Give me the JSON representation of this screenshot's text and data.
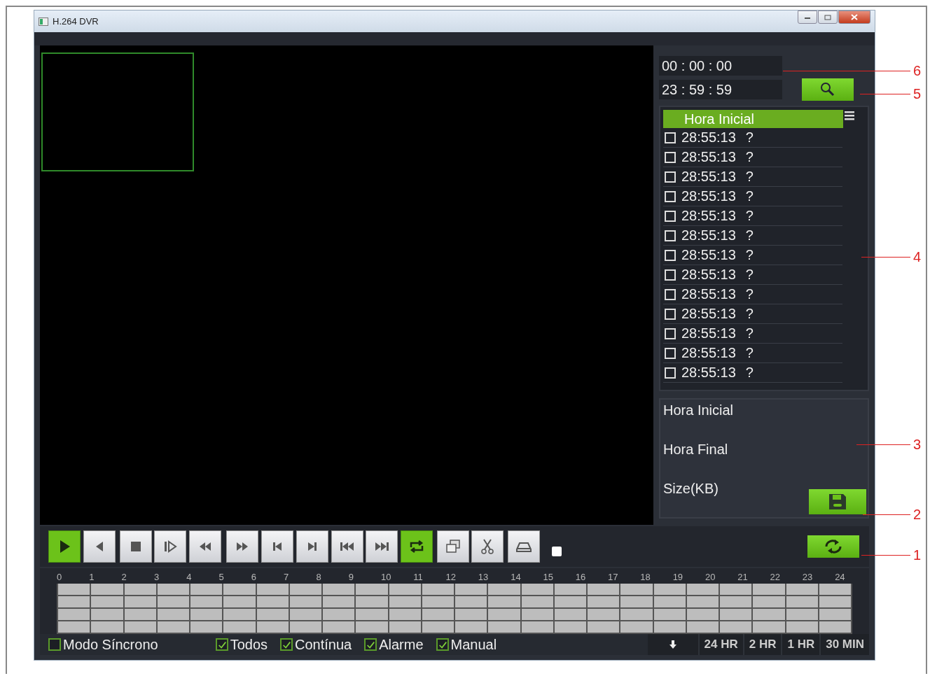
{
  "window": {
    "title": "H.264 DVR"
  },
  "time_range": {
    "start": "00 : 00 : 00",
    "end": "23 : 59 : 59"
  },
  "file_list": {
    "header": "Hora Inicial",
    "rows": [
      {
        "time": "28:55:13",
        "status": "?",
        "checked": false
      },
      {
        "time": "28:55:13",
        "status": "?",
        "checked": false
      },
      {
        "time": "28:55:13",
        "status": "?",
        "checked": false
      },
      {
        "time": "28:55:13",
        "status": "?",
        "checked": false
      },
      {
        "time": "28:55:13",
        "status": "?",
        "checked": false
      },
      {
        "time": "28:55:13",
        "status": "?",
        "checked": false
      },
      {
        "time": "28:55:13",
        "status": "?",
        "checked": false
      },
      {
        "time": "28:55:13",
        "status": "?",
        "checked": false
      },
      {
        "time": "28:55:13",
        "status": "?",
        "checked": false
      },
      {
        "time": "28:55:13",
        "status": "?",
        "checked": false
      },
      {
        "time": "28:55:13",
        "status": "?",
        "checked": false
      },
      {
        "time": "28:55:13",
        "status": "?",
        "checked": false
      },
      {
        "time": "28:55:13",
        "status": "?",
        "checked": false
      }
    ]
  },
  "info": {
    "labels": [
      "Hora Inicial",
      "Hora Final",
      "Size(KB)"
    ]
  },
  "toolbar": {
    "buttons": [
      {
        "kind": "play",
        "on": true
      },
      {
        "kind": "back",
        "on": false
      },
      {
        "kind": "stop",
        "on": false
      },
      {
        "kind": "step",
        "on": false
      },
      {
        "kind": "rewind",
        "on": false
      },
      {
        "kind": "forward",
        "on": false
      },
      {
        "kind": "first",
        "on": false
      },
      {
        "kind": "last",
        "on": false
      },
      {
        "kind": "skipback",
        "on": false
      },
      {
        "kind": "skipforward",
        "on": false
      },
      {
        "kind": "loop",
        "on": true
      },
      {
        "kind": "windows",
        "on": false
      },
      {
        "kind": "cut",
        "on": false
      },
      {
        "kind": "drive",
        "on": false
      }
    ]
  },
  "timeline": {
    "hours": [
      "0",
      "1",
      "2",
      "3",
      "4",
      "5",
      "6",
      "7",
      "8",
      "9",
      "10",
      "11",
      "12",
      "13",
      "14",
      "15",
      "16",
      "17",
      "18",
      "19",
      "20",
      "21",
      "22",
      "23",
      "24"
    ]
  },
  "filters": [
    {
      "label": "Modo Síncrono",
      "checked": false
    },
    {
      "label": "Todos",
      "checked": true
    },
    {
      "label": "Contínua",
      "checked": true
    },
    {
      "label": "Alarme",
      "checked": true
    },
    {
      "label": "Manual",
      "checked": true
    }
  ],
  "zoom_buttons": [
    "24 HR",
    "2 HR",
    "1 HR",
    "30 MIN"
  ],
  "callouts": [
    {
      "number": "6"
    },
    {
      "number": "5"
    },
    {
      "number": "4"
    },
    {
      "number": "3"
    },
    {
      "number": "2"
    },
    {
      "number": "1"
    }
  ]
}
